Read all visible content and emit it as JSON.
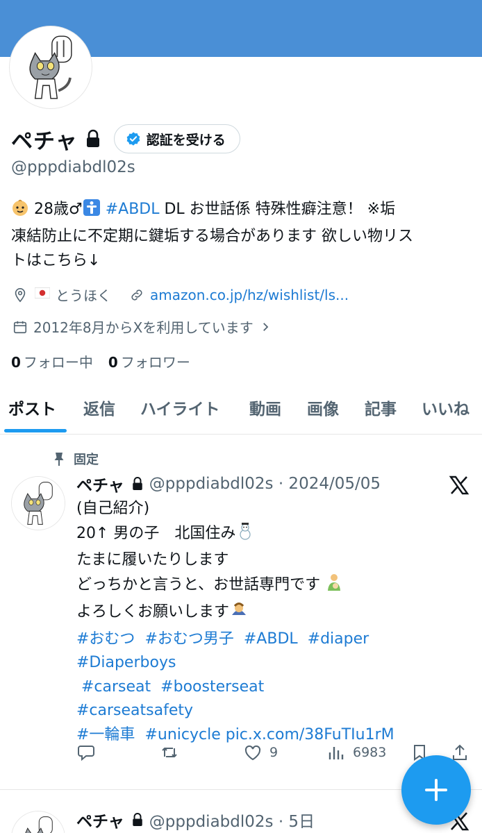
{
  "profile": {
    "display_name": "ペチャ",
    "verify_label": "認証を受ける",
    "handle": "@pppdiabdl02s",
    "bio": {
      "line1_a": " 28歳♂",
      "line1_tag": "#ABDL",
      "line1_b": " DL お世話係 特殊性癖注意！ ※垢",
      "line2": "凍結防止に不定期に鍵垢する場合があります 欲しい物リス",
      "line3": "トはこちら↓"
    },
    "location": "とうほく",
    "website": "amazon.co.jp/hz/wishlist/ls...",
    "joined": "2012年8月からXを利用しています",
    "following_count": "0",
    "following_label": "フォロー中",
    "followers_count": "0",
    "followers_label": "フォロワー"
  },
  "tabs": [
    {
      "label": "ポスト",
      "active": true
    },
    {
      "label": "返信"
    },
    {
      "label": "ハイライト"
    },
    {
      "label": "動画"
    },
    {
      "label": "画像"
    },
    {
      "label": "記事"
    },
    {
      "label": "いいね"
    }
  ],
  "pinned_label": "固定",
  "tweet": {
    "name": "ペチャ",
    "handle_date": "@pppdiabdl02s · 2024/05/05",
    "lines": [
      "(自己紹介)",
      "20↑ 男の子　北国住み",
      "たまに履いたりします",
      "どっちかと言うと、お世話専門です",
      "よろしくお願いします"
    ],
    "tags": {
      "l1": [
        "#おむつ",
        "#おむつ男子",
        "#ABDL",
        "#diaper"
      ],
      "l2": "#Diaperboys",
      "l3": [
        "#carseat",
        "#boosterseat"
      ],
      "l4": "#carseatsafety",
      "l5": [
        "#一輪車",
        "#unicycle"
      ],
      "pic": "pic.x.com/38FuTIu1rM"
    },
    "likes": "9",
    "views": "6983"
  },
  "tweet2": {
    "name": "ペチャ",
    "handle_date": "@pppdiabdl02s · 5日"
  },
  "icons": [
    "lock-icon",
    "verified-badge-icon",
    "location-pin-icon",
    "link-icon",
    "calendar-icon",
    "chevron-right-icon",
    "pin-icon",
    "x-logo-icon",
    "reply-icon",
    "retweet-icon",
    "like-icon",
    "views-icon",
    "bookmark-icon",
    "share-icon",
    "compose-plus-icon"
  ],
  "colors": {
    "banner": "#4a8fd6",
    "link": "#1d7bd3",
    "accent": "#1d9bf0",
    "secondary_text": "#536471"
  }
}
